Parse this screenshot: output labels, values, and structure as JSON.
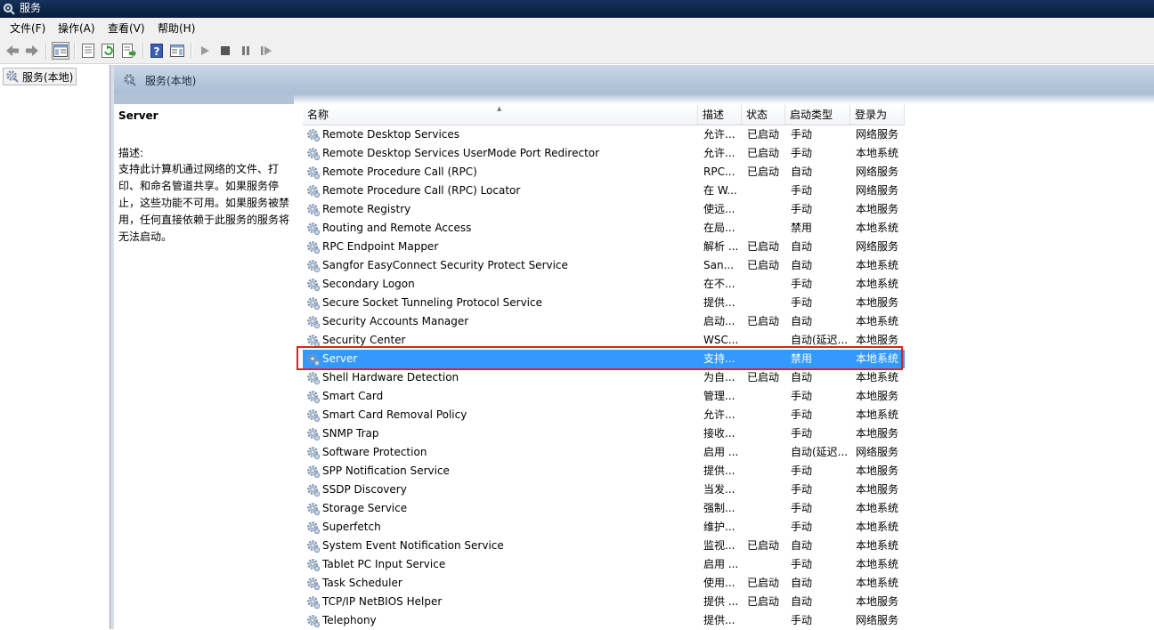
{
  "window": {
    "title": "服务"
  },
  "menu": [
    "文件(F)",
    "操作(A)",
    "查看(V)",
    "帮助(H)"
  ],
  "toolbar": {
    "icons": [
      "back-icon",
      "forward-icon",
      "show-hide-tree-icon",
      "properties-icon",
      "refresh-icon",
      "export-list-icon",
      "help-icon",
      "show-hide-action-pane-icon",
      "start-service-icon",
      "stop-service-icon",
      "pause-service-icon",
      "restart-service-icon"
    ]
  },
  "tree": {
    "root_label": "服务(本地)"
  },
  "panel": {
    "header": "服务(本地)",
    "selected_service": "Server",
    "desc_label": "描述:",
    "desc_text": "支持此计算机通过网络的文件、打印、和命名管道共享。如果服务停止，这些功能不可用。如果服务被禁用，任何直接依赖于此服务的服务将无法启动。"
  },
  "columns": {
    "name": "名称",
    "desc": "描述",
    "status": "状态",
    "startup": "启动类型",
    "logon": "登录为"
  },
  "rows": [
    {
      "name": "Remote Desktop Services",
      "desc": "允许...",
      "status": "已启动",
      "startup": "手动",
      "logon": "网络服务"
    },
    {
      "name": "Remote Desktop Services UserMode Port Redirector",
      "desc": "允许...",
      "status": "已启动",
      "startup": "手动",
      "logon": "本地系统"
    },
    {
      "name": "Remote Procedure Call (RPC)",
      "desc": "RPC...",
      "status": "已启动",
      "startup": "自动",
      "logon": "网络服务"
    },
    {
      "name": "Remote Procedure Call (RPC) Locator",
      "desc": "在 W...",
      "status": "",
      "startup": "手动",
      "logon": "网络服务"
    },
    {
      "name": "Remote Registry",
      "desc": "使远...",
      "status": "",
      "startup": "手动",
      "logon": "本地服务"
    },
    {
      "name": "Routing and Remote Access",
      "desc": "在局...",
      "status": "",
      "startup": "禁用",
      "logon": "本地系统"
    },
    {
      "name": "RPC Endpoint Mapper",
      "desc": "解析 ...",
      "status": "已启动",
      "startup": "自动",
      "logon": "网络服务"
    },
    {
      "name": "Sangfor EasyConnect Security Protect Service",
      "desc": "San...",
      "status": "已启动",
      "startup": "自动",
      "logon": "本地系统"
    },
    {
      "name": "Secondary Logon",
      "desc": "在不...",
      "status": "",
      "startup": "手动",
      "logon": "本地系统"
    },
    {
      "name": "Secure Socket Tunneling Protocol Service",
      "desc": "提供...",
      "status": "",
      "startup": "手动",
      "logon": "本地服务"
    },
    {
      "name": "Security Accounts Manager",
      "desc": "启动...",
      "status": "已启动",
      "startup": "自动",
      "logon": "本地系统"
    },
    {
      "name": "Security Center",
      "desc": "WSC...",
      "status": "",
      "startup": "自动(延迟...",
      "logon": "本地服务"
    },
    {
      "name": "Server",
      "desc": "支持...",
      "status": "",
      "startup": "禁用",
      "logon": "本地系统"
    },
    {
      "name": "Shell Hardware Detection",
      "desc": "为自...",
      "status": "已启动",
      "startup": "自动",
      "logon": "本地系统"
    },
    {
      "name": "Smart Card",
      "desc": "管理...",
      "status": "",
      "startup": "手动",
      "logon": "本地服务"
    },
    {
      "name": "Smart Card Removal Policy",
      "desc": "允许...",
      "status": "",
      "startup": "手动",
      "logon": "本地系统"
    },
    {
      "name": "SNMP Trap",
      "desc": "接收...",
      "status": "",
      "startup": "手动",
      "logon": "本地服务"
    },
    {
      "name": "Software Protection",
      "desc": "启用 ...",
      "status": "",
      "startup": "自动(延迟...",
      "logon": "网络服务"
    },
    {
      "name": "SPP Notification Service",
      "desc": "提供...",
      "status": "",
      "startup": "手动",
      "logon": "本地服务"
    },
    {
      "name": "SSDP Discovery",
      "desc": "当发...",
      "status": "",
      "startup": "手动",
      "logon": "本地服务"
    },
    {
      "name": "Storage Service",
      "desc": "强制...",
      "status": "",
      "startup": "手动",
      "logon": "本地系统"
    },
    {
      "name": "Superfetch",
      "desc": "维护...",
      "status": "",
      "startup": "手动",
      "logon": "本地系统"
    },
    {
      "name": "System Event Notification Service",
      "desc": "监视...",
      "status": "已启动",
      "startup": "自动",
      "logon": "本地系统"
    },
    {
      "name": "Tablet PC Input Service",
      "desc": "启用 ...",
      "status": "",
      "startup": "手动",
      "logon": "本地系统"
    },
    {
      "name": "Task Scheduler",
      "desc": "使用...",
      "status": "已启动",
      "startup": "自动",
      "logon": "本地系统"
    },
    {
      "name": "TCP/IP NetBIOS Helper",
      "desc": "提供 ...",
      "status": "已启动",
      "startup": "自动",
      "logon": "本地服务"
    },
    {
      "name": "Telephony",
      "desc": "提供...",
      "status": "",
      "startup": "手动",
      "logon": "网络服务"
    }
  ],
  "selected_row_index": 12,
  "colors": {
    "selection": "#3399ff",
    "highlight_box": "#e02020",
    "header_band": "#a9bdd4"
  }
}
